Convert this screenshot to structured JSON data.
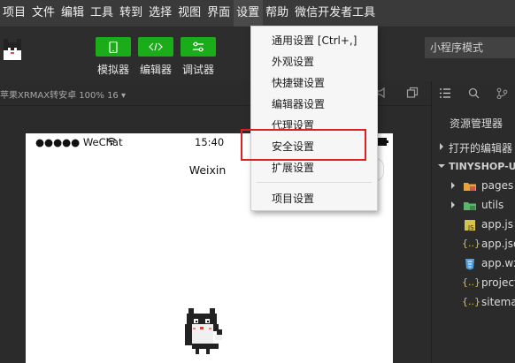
{
  "menubar": {
    "items": [
      "项目",
      "文件",
      "编辑",
      "工具",
      "转到",
      "选择",
      "视图",
      "界面",
      "设置",
      "帮助",
      "微信开发者工具"
    ]
  },
  "toolbar": {
    "simulator_label": "模拟器",
    "editor_label": "编辑器",
    "debugger_label": "调试器",
    "mode_select_value": "小程序模式"
  },
  "subbar": {
    "device_label": "苹果XRMAX转安卓 100% 16 ▾"
  },
  "simulator": {
    "carrier": "●●●●● WeChat",
    "time": "15:40",
    "nav_title": "Weixin"
  },
  "explorer": {
    "title": "资源管理器",
    "open_editors": "打开的编辑器",
    "project": "TINYSHOP-UNI",
    "items": [
      {
        "name": "pages",
        "type": "folder"
      },
      {
        "name": "utils",
        "type": "folder"
      },
      {
        "name": "app.js",
        "type": "js"
      },
      {
        "name": "app.json",
        "type": "json"
      },
      {
        "name": "app.wxss",
        "type": "css"
      },
      {
        "name": "project.config.json",
        "type": "json"
      },
      {
        "name": "sitemap.json",
        "type": "json"
      }
    ]
  },
  "settings_menu": {
    "items": [
      "通用设置  [Ctrl+,]",
      "外观设置",
      "快捷键设置",
      "编辑器设置",
      "代理设置",
      "安全设置",
      "扩展设置",
      "项目设置"
    ]
  },
  "colors": {
    "accent_green": "#1aad19",
    "highlight_red": "#e02020",
    "folder_orange": "#e8a33d",
    "folder_green": "#5bb56a",
    "js_yellow": "#d8c34a",
    "css_blue": "#4f9fe0"
  }
}
